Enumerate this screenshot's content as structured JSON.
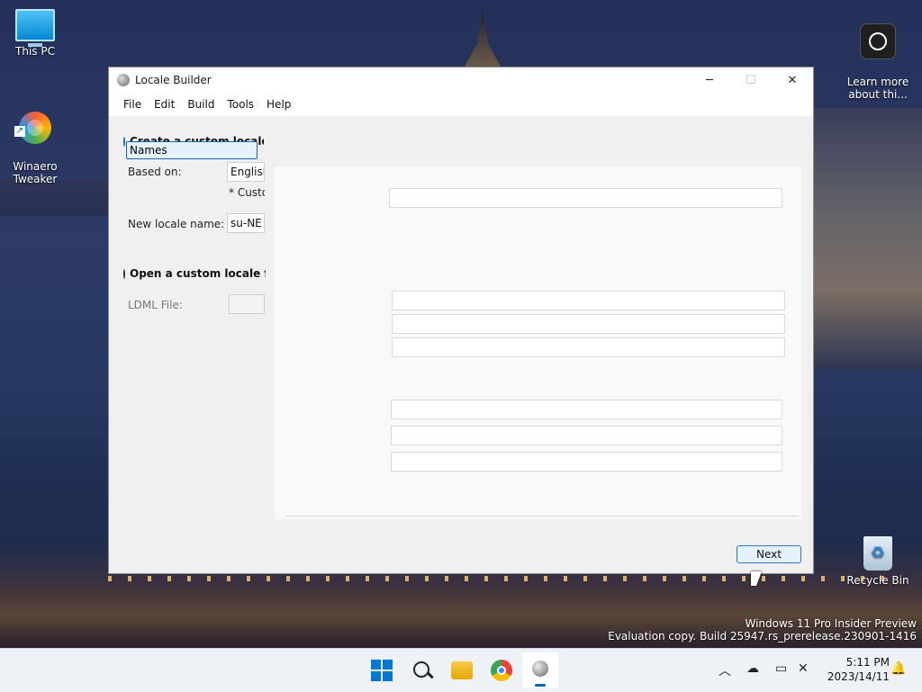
{
  "desktop": {
    "icons": [
      {
        "label": "This PC"
      },
      {
        "label": "Winaero\nTweaker"
      },
      {
        "label": "Learn more\nabout thi..."
      },
      {
        "label": "Recycle Bin"
      }
    ],
    "watermark": {
      "line1": "Windows 11 Pro Insider Preview",
      "line2": "Evaluation copy. Build 25947.rs_prerelease.230901-1416"
    }
  },
  "window": {
    "title": "Locale Builder",
    "controls": {
      "minimize": "─",
      "maximize": "☐",
      "close": "✕"
    },
    "menu": [
      "File",
      "Edit",
      "Build",
      "Tools",
      "Help"
    ],
    "left": {
      "option_create": "Create a custom locale fr",
      "dropdown_value": "Names",
      "based_on_label": "Based on:",
      "based_on_value": "English",
      "custom_note": "* Custom",
      "new_locale_label": "New locale name:",
      "new_locale_value": "su-NE",
      "option_open": "Open a custom locale fro",
      "ldml_label": "LDML File:",
      "ldml_value": ""
    },
    "next_label": "Next"
  },
  "taskbar": {
    "time": "5:11 PM",
    "date": "2023/14/11"
  }
}
